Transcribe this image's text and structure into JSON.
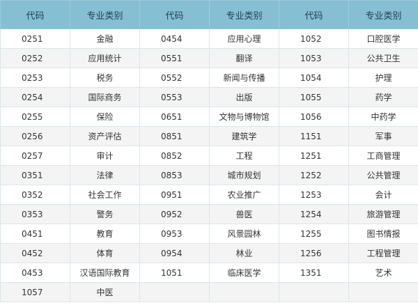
{
  "headers": [
    "代码",
    "专业类别",
    "代码",
    "专业类别",
    "代码",
    "专业类别"
  ],
  "rows": [
    [
      "0251",
      "金融",
      "0454",
      "应用心理",
      "1052",
      "口腔医学"
    ],
    [
      "0252",
      "应用统计",
      "0551",
      "翻译",
      "1053",
      "公共卫生"
    ],
    [
      "0253",
      "税务",
      "0552",
      "新闻与传播",
      "1054",
      "护理"
    ],
    [
      "0254",
      "国际商务",
      "0553",
      "出版",
      "1055",
      "药学"
    ],
    [
      "0255",
      "保险",
      "0651",
      "文物与博物馆",
      "1056",
      "中药学"
    ],
    [
      "0256",
      "资产评估",
      "0851",
      "建筑学",
      "1151",
      "军事"
    ],
    [
      "0257",
      "审计",
      "0852",
      "工程",
      "1251",
      "工商管理"
    ],
    [
      "0351",
      "法律",
      "0853",
      "城市规划",
      "1252",
      "公共管理"
    ],
    [
      "0352",
      "社会工作",
      "0951",
      "农业推广",
      "1253",
      "会计"
    ],
    [
      "0353",
      "警务",
      "0952",
      "兽医",
      "1254",
      "旅游管理"
    ],
    [
      "0451",
      "教育",
      "0953",
      "风景园林",
      "1255",
      "图书情报"
    ],
    [
      "0452",
      "体育",
      "0954",
      "林业",
      "1256",
      "工程管理"
    ],
    [
      "0453",
      "汉语国际教育",
      "1051",
      "临床医学",
      "1351",
      "艺术"
    ],
    [
      "1057",
      "中医",
      "",
      "",
      "",
      ""
    ]
  ]
}
